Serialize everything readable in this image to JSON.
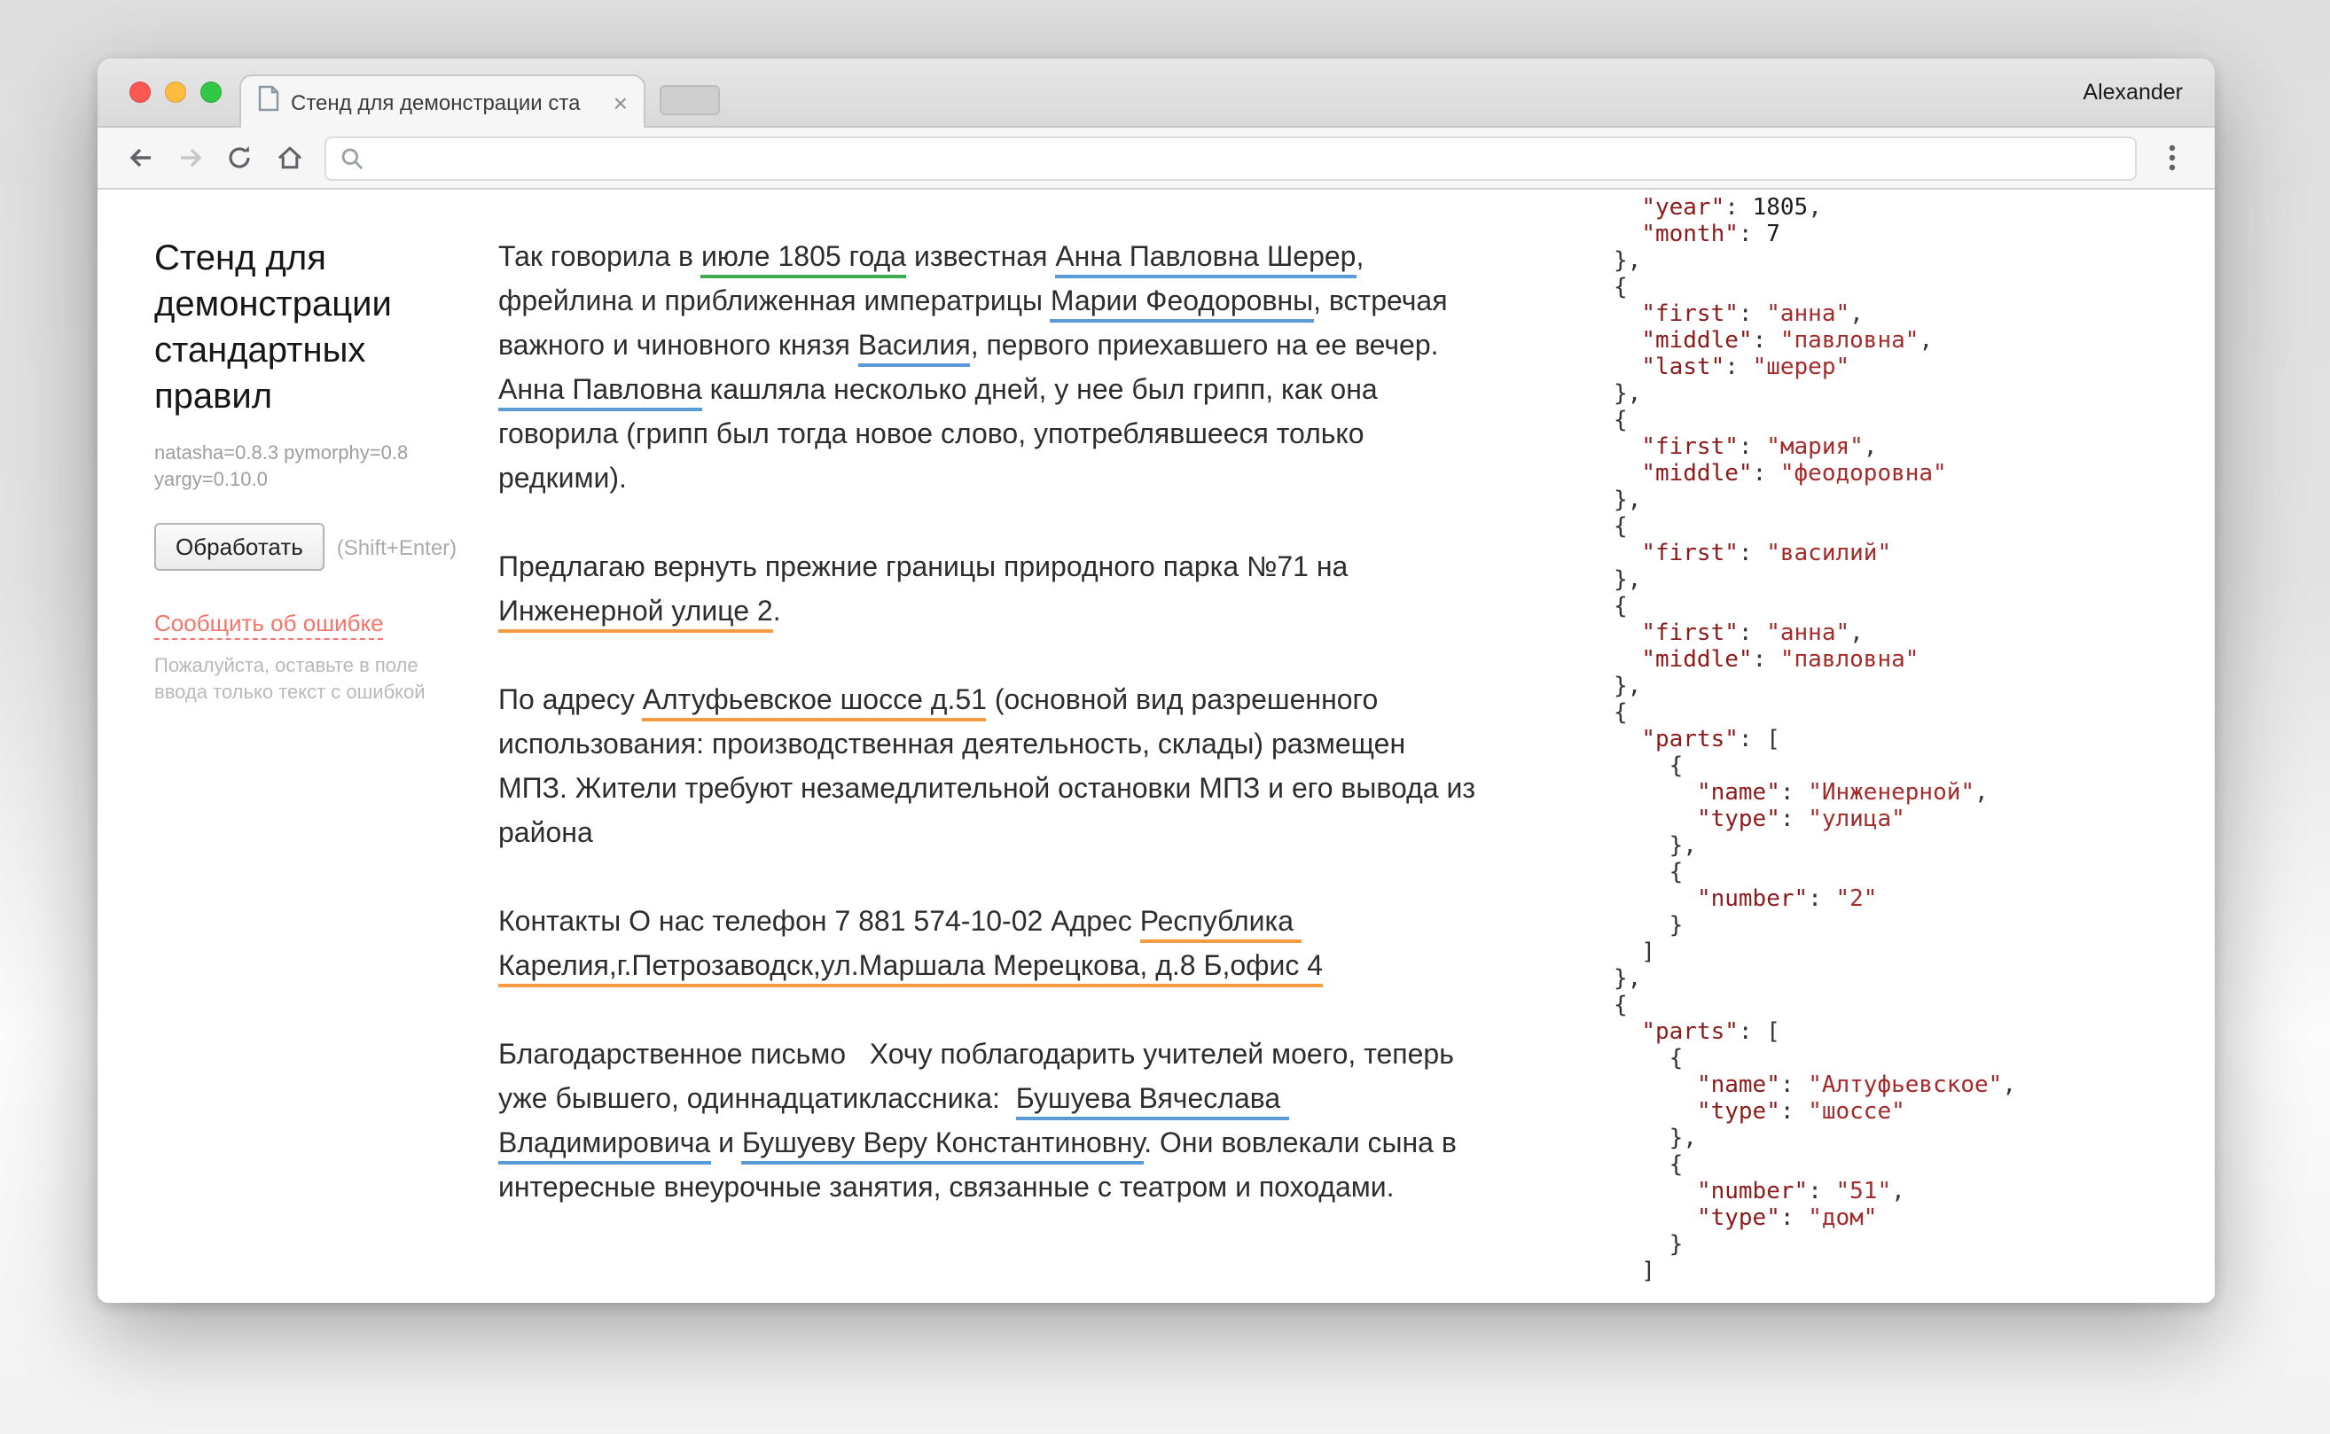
{
  "window": {
    "tab_title": "Стенд для демонстрации ста",
    "tab_close": "×",
    "profile_name": "Alexander"
  },
  "toolbar": {
    "address_value": ""
  },
  "sidebar": {
    "title": "Стенд для демонстрации стандартных правил",
    "versions": "natasha=0.8.3 pymorphy=0.8 yargy=0.10.0",
    "process_button": "Обработать",
    "process_hint": "(Shift+Enter)",
    "report_link": "Сообщить об ошибке",
    "report_note": "Пожалуйста, оставьте в поле ввода только текст с ошибкой"
  },
  "colors": {
    "date_underline": "#3faa51",
    "name_underline": "#5b9bd5",
    "address_underline": "#f59b42",
    "report_link": "#f4756b",
    "json_key": "#8e1b1b",
    "json_string": "#a52a2a"
  },
  "document": {
    "paragraphs": [
      {
        "segments": [
          {
            "type": "plain",
            "text": "Так говорила в "
          },
          {
            "type": "date",
            "text": "июле 1805 года"
          },
          {
            "type": "plain",
            "text": " известная "
          },
          {
            "type": "name",
            "text": "Анна Павловна Шерер"
          },
          {
            "type": "plain",
            "text": ", фрейлина и приближенная императрицы "
          },
          {
            "type": "name",
            "text": "Марии Феодоровны"
          },
          {
            "type": "plain",
            "text": ", встречая важного и чиновного князя "
          },
          {
            "type": "name",
            "text": "Василия"
          },
          {
            "type": "plain",
            "text": ", первого приехавшего на ее вечер. "
          },
          {
            "type": "name",
            "text": "Анна Павловна"
          },
          {
            "type": "plain",
            "text": " кашляла несколько дней, у нее был грипп, как она говорила (грипп был тогда новое слово, употреблявшееся только редкими)."
          }
        ]
      },
      {
        "segments": [
          {
            "type": "plain",
            "text": "Предлагаю вернуть прежние границы природного парка №71 на "
          },
          {
            "type": "address",
            "text": "Инженерной улице 2"
          },
          {
            "type": "plain",
            "text": "."
          }
        ]
      },
      {
        "segments": [
          {
            "type": "plain",
            "text": "По адресу "
          },
          {
            "type": "address",
            "text": "Алтуфьевское шоссе д.51"
          },
          {
            "type": "plain",
            "text": " (основной вид разрешенного использования: производственная деятельность, склады) размещен МПЗ. Жители требуют незамедлительной остановки МПЗ и его вывода из района"
          }
        ]
      },
      {
        "segments": [
          {
            "type": "plain",
            "text": "Контакты О нас телефон 7 881 574-10-02 Адрес "
          },
          {
            "type": "address",
            "text": "Республика Карелия,г.Петрозаводск,ул.Маршала Мерецкова, д.8 Б,офис 4"
          }
        ]
      },
      {
        "segments": [
          {
            "type": "plain",
            "text": "Благодарственное письмо   Хочу поблагодарить учителей моего, теперь уже бывшего, одиннадцатиклассника:  "
          },
          {
            "type": "name",
            "text": "Бушуева Вячеслава Владимировича"
          },
          {
            "type": "plain",
            "text": " и "
          },
          {
            "type": "name",
            "text": "Бушуеву Веру Константиновну"
          },
          {
            "type": "plain",
            "text": ". Они вовлекали сына в интересные внеурочные занятия, связанные с театром и походами."
          }
        ]
      }
    ]
  },
  "json_panel": {
    "lines": [
      "  \"year\": 1805,",
      "  \"month\": 7",
      "},",
      "{",
      "  \"first\": \"анна\",",
      "  \"middle\": \"павловна\",",
      "  \"last\": \"шерер\"",
      "},",
      "{",
      "  \"first\": \"мария\",",
      "  \"middle\": \"феодоровна\"",
      "},",
      "{",
      "  \"first\": \"василий\"",
      "},",
      "{",
      "  \"first\": \"анна\",",
      "  \"middle\": \"павловна\"",
      "},",
      "{",
      "  \"parts\": [",
      "    {",
      "      \"name\": \"Инженерной\",",
      "      \"type\": \"улица\"",
      "    },",
      "    {",
      "      \"number\": \"2\"",
      "    }",
      "  ]",
      "},",
      "{",
      "  \"parts\": [",
      "    {",
      "      \"name\": \"Алтуфьевское\",",
      "      \"type\": \"шоссе\"",
      "    },",
      "    {",
      "      \"number\": \"51\",",
      "      \"type\": \"дом\"",
      "    }",
      "  ]"
    ]
  }
}
